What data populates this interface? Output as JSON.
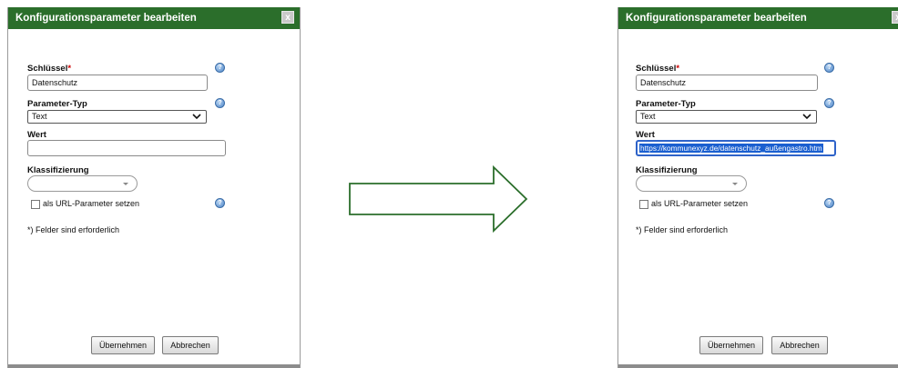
{
  "dialog": {
    "title": "Konfigurationsparameter bearbeiten",
    "close_label": "x",
    "key_label": "Schlüssel",
    "required_mark": "*",
    "key_value": "Datenschutz",
    "type_label": "Parameter-Typ",
    "type_value": "Text",
    "value_label": "Wert",
    "classification_label": "Klassifizierung",
    "url_param_label": "als URL-Parameter setzen",
    "required_note": "*) Felder sind erforderlich",
    "apply_label": "Übernehmen",
    "cancel_label": "Abbrechen",
    "help_glyph": "?"
  },
  "before": {
    "value": ""
  },
  "after": {
    "value": "https://kommunexyz.de/datenschutz_außengastro.htm"
  },
  "colors": {
    "titlebar": "#2b6e2b",
    "arrow": "#2b6e2b",
    "selection": "#1a5fd0"
  }
}
